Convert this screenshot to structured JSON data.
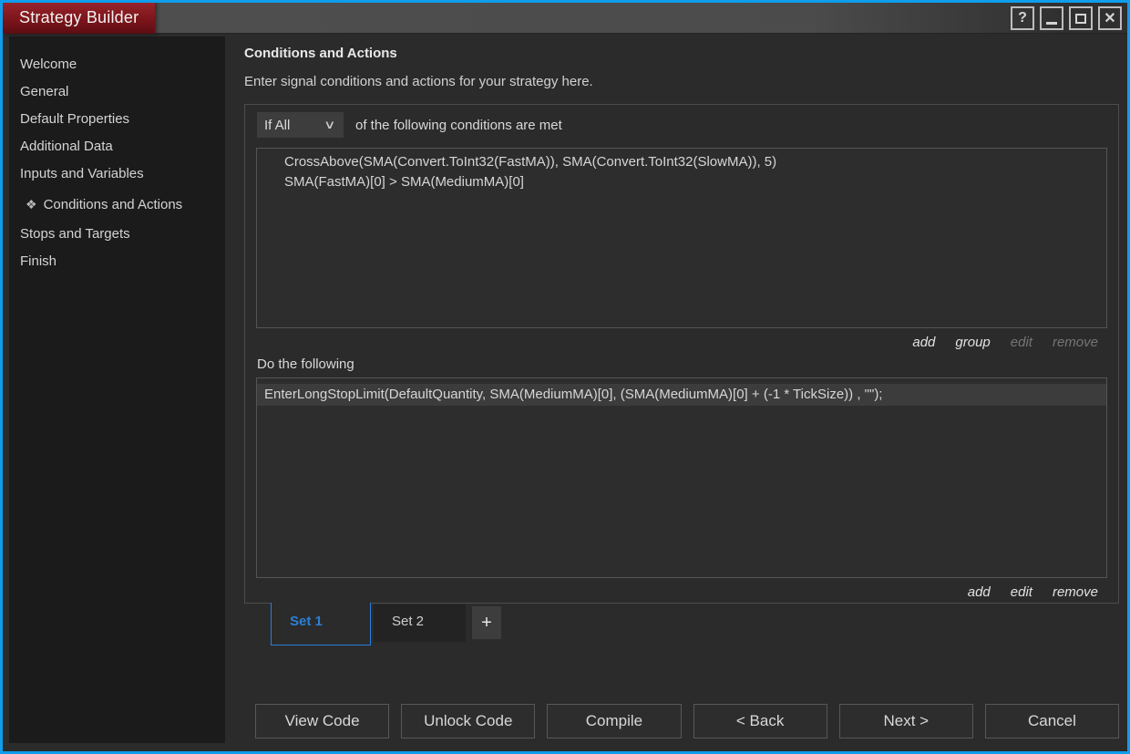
{
  "window": {
    "title": "Strategy Builder"
  },
  "titlebar_controls": {
    "help": "?",
    "close": "✕"
  },
  "sidebar": {
    "active_icon": "❖",
    "items": [
      {
        "label": "Welcome"
      },
      {
        "label": "General"
      },
      {
        "label": "Default Properties"
      },
      {
        "label": "Additional Data"
      },
      {
        "label": "Inputs and Variables"
      },
      {
        "label": "Conditions and Actions"
      },
      {
        "label": "Stops and Targets"
      },
      {
        "label": "Finish"
      }
    ]
  },
  "content": {
    "heading": "Conditions and Actions",
    "subtitle": "Enter signal conditions and actions for your strategy here.",
    "conditions_group": {
      "selector_value": "If All",
      "selector_chevron": "∨",
      "selector_suffix": "of the following conditions are met",
      "rows": [
        {
          "text": "CrossAbove(SMA(Convert.ToInt32(FastMA)), SMA(Convert.ToInt32(SlowMA)), 5)"
        },
        {
          "text": "SMA(FastMA)[0] > SMA(MediumMA)[0]"
        }
      ],
      "links": [
        {
          "label": "add",
          "enabled": true
        },
        {
          "label": "group",
          "enabled": true
        },
        {
          "label": "edit",
          "enabled": false
        },
        {
          "label": "remove",
          "enabled": false
        }
      ]
    },
    "actions_group": {
      "label": "Do the following",
      "rows": [
        {
          "text": "EnterLongStopLimit(DefaultQuantity, SMA(MediumMA)[0], (SMA(MediumMA)[0] + (-1 * TickSize)) , \"\");"
        }
      ],
      "links": [
        {
          "label": "add",
          "enabled": true
        },
        {
          "label": "edit",
          "enabled": true
        },
        {
          "label": "remove",
          "enabled": true
        }
      ]
    },
    "tabs": [
      {
        "label": "Set 1",
        "active": true
      },
      {
        "label": "Set 2",
        "active": false
      }
    ],
    "add_tab_label": "+",
    "footer_buttons": [
      {
        "label": "View Code"
      },
      {
        "label": "Unlock Code"
      },
      {
        "label": "Compile"
      },
      {
        "label": "< Back"
      },
      {
        "label": "Next >"
      },
      {
        "label": "Cancel"
      }
    ]
  },
  "colors": {
    "window_border": "#0f9ded",
    "accent_blue": "#2b7fd3",
    "badge_red": "#7c151b",
    "sidebar_bg": "#1b1b1b",
    "main_bg": "#2b2b2b",
    "row_highlight": "#3c3c3c"
  }
}
